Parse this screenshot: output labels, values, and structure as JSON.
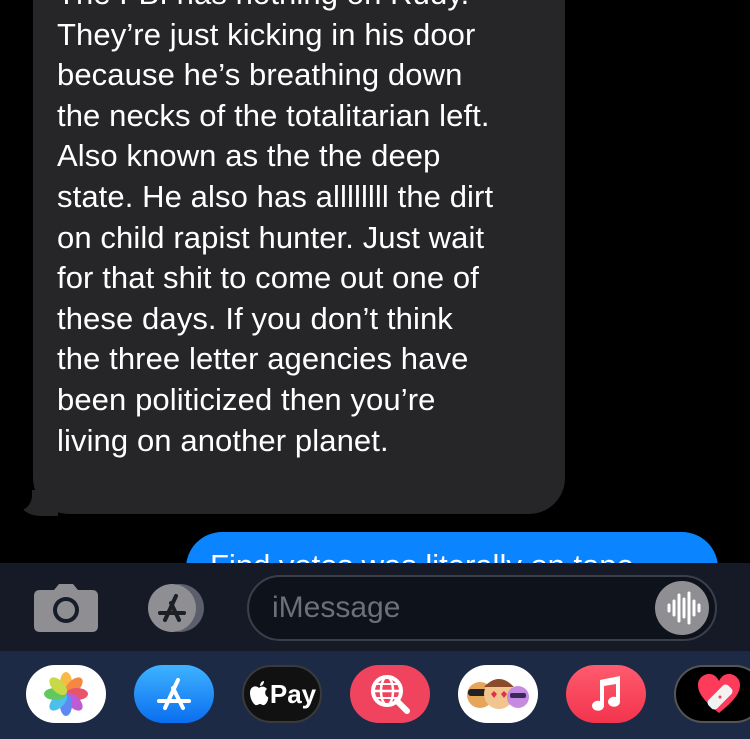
{
  "conversation": {
    "incoming_message": "The FBI has nothing on Rudy.\nThey’re just kicking in his door\nbecause he’s breathing down\nthe necks of the totalitarian left.\nAlso known as the the deep\nstate. He also has allllllll the dirt\non child rapist hunter. Just wait\nfor that shit to come out one of\nthese days. If you don’t think\nthe three letter agencies have\nbeen politicized then you’re\nliving on another planet.",
    "outgoing_message_partial": "Find votes was literally on tape"
  },
  "composer": {
    "placeholder": "iMessage",
    "camera_icon": "camera-icon",
    "apps_icon": "app-store-icon",
    "dictation_icon": "waveform-icon"
  },
  "app_drawer": {
    "items": [
      {
        "name": "Photos",
        "icon": "photos-icon"
      },
      {
        "name": "App Store",
        "icon": "app-store-icon"
      },
      {
        "name": "Apple Pay",
        "label": "Pay",
        "icon": "apple-logo-icon"
      },
      {
        "name": "Image Search",
        "icon": "globe-search-icon"
      },
      {
        "name": "Memoji",
        "icon": "memoji-icon"
      },
      {
        "name": "Music",
        "icon": "music-note-icon"
      },
      {
        "name": "Fitness",
        "icon": "heart-bandage-icon"
      }
    ]
  },
  "colors": {
    "incoming_bubble": "#262629",
    "outgoing_bubble": "#0a84ff",
    "composer_bg": "#161c28",
    "drawer_bg": "#1c2a45"
  }
}
